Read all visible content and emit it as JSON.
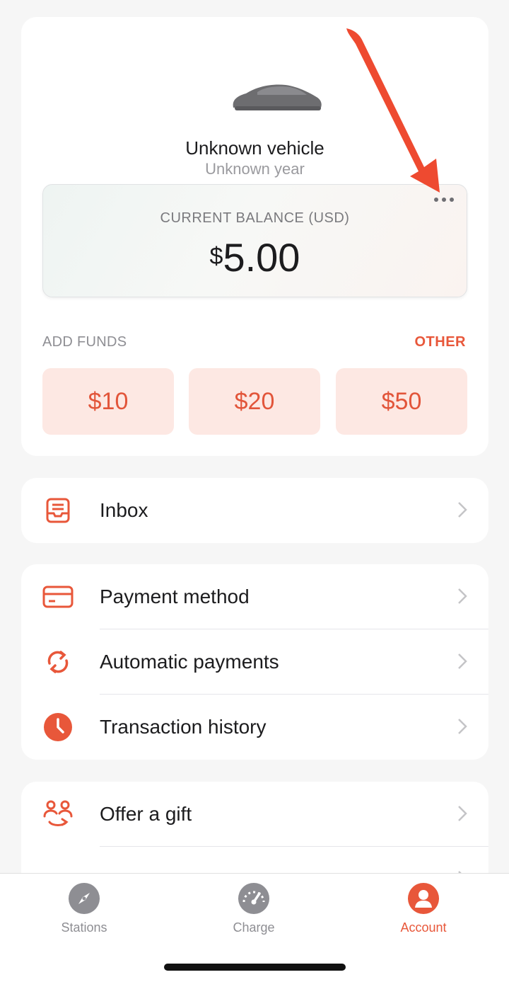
{
  "vehicle": {
    "name": "Unknown vehicle",
    "year": "Unknown year"
  },
  "balance": {
    "label": "CURRENT BALANCE (USD)",
    "currency_symbol": "$",
    "amount": "5.00",
    "more_icon": "ellipsis-icon"
  },
  "add_funds": {
    "label": "ADD FUNDS",
    "other_label": "OTHER",
    "amounts": [
      "$10",
      "$20",
      "$50"
    ]
  },
  "menu": {
    "inbox": {
      "label": "Inbox",
      "icon": "inbox-icon"
    },
    "payment_method": {
      "label": "Payment method",
      "icon": "credit-card-icon"
    },
    "automatic_payments": {
      "label": "Automatic payments",
      "icon": "refresh-icon"
    },
    "transaction_history": {
      "label": "Transaction history",
      "icon": "clock-icon"
    },
    "offer_gift": {
      "label": "Offer a gift",
      "icon": "people-gift-icon"
    }
  },
  "tabs": [
    {
      "label": "Stations",
      "icon": "compass-icon",
      "active": false
    },
    {
      "label": "Charge",
      "icon": "speedometer-icon",
      "active": false
    },
    {
      "label": "Account",
      "icon": "user-icon",
      "active": true
    }
  ],
  "colors": {
    "accent": "#e8573a",
    "fund_button_bg": "#fde8e3",
    "annotation_arrow": "#ee4a30"
  }
}
